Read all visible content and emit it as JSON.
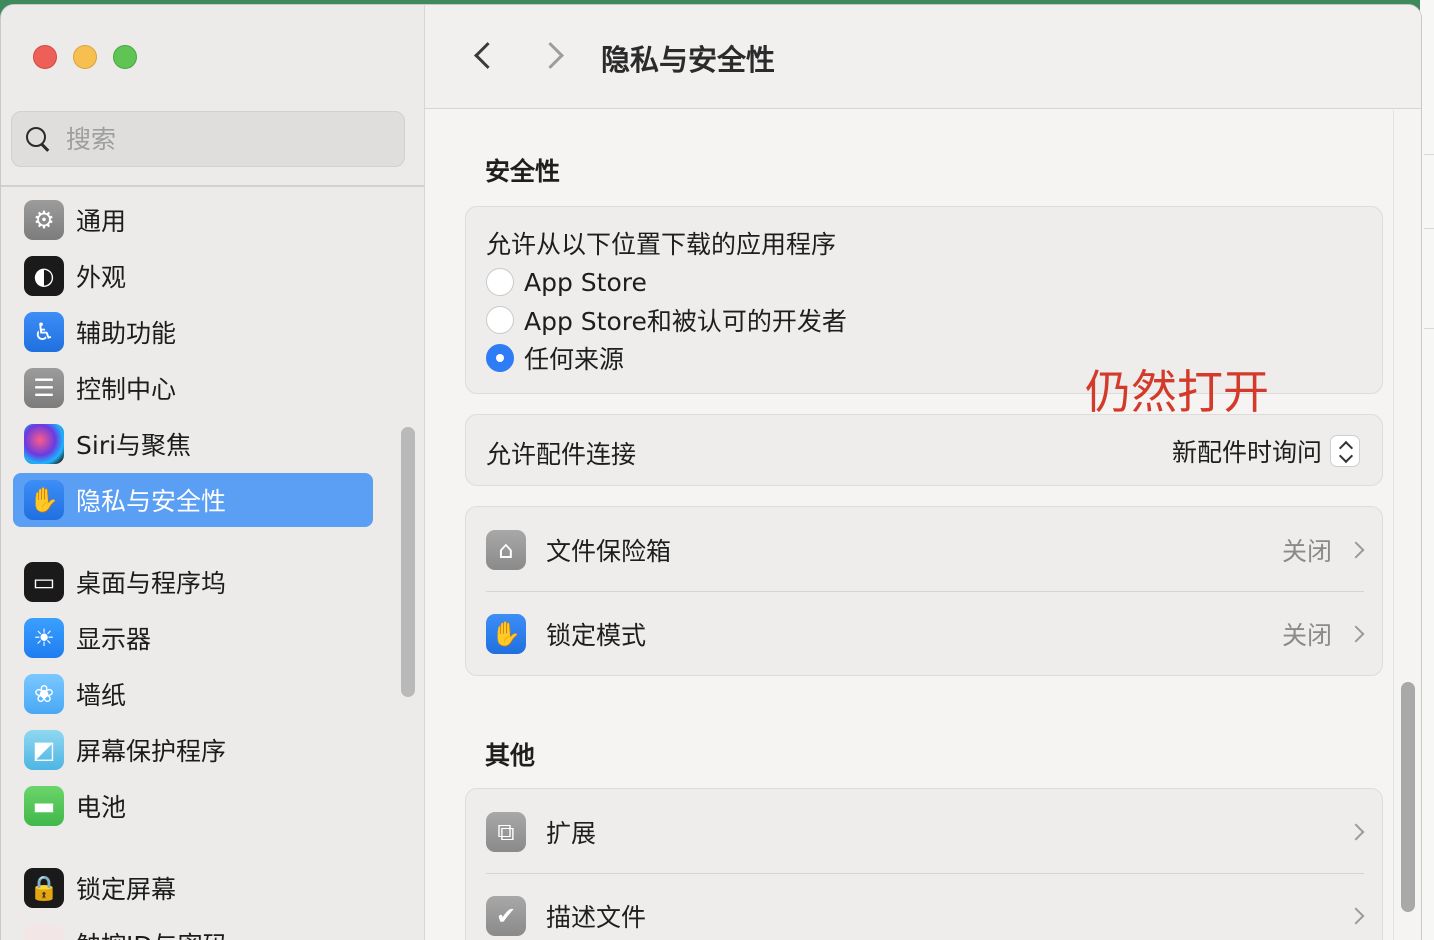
{
  "window": {
    "title": "隐私与安全性"
  },
  "search": {
    "placeholder": "搜索"
  },
  "sidebar": {
    "items": [
      {
        "label": "通用",
        "icon": "gear-icon"
      },
      {
        "label": "外观",
        "icon": "appearance-icon"
      },
      {
        "label": "辅助功能",
        "icon": "accessibility-icon"
      },
      {
        "label": "控制中心",
        "icon": "toggles-icon"
      },
      {
        "label": "Siri与聚焦",
        "icon": "siri-icon"
      },
      {
        "label": "隐私与安全性",
        "icon": "hand-icon",
        "active": true
      },
      {
        "label": "桌面与程序坞",
        "icon": "dock-icon"
      },
      {
        "label": "显示器",
        "icon": "sun-icon"
      },
      {
        "label": "墙纸",
        "icon": "flower-icon"
      },
      {
        "label": "屏幕保护程序",
        "icon": "screensaver-icon"
      },
      {
        "label": "电池",
        "icon": "battery-icon"
      },
      {
        "label": "锁定屏幕",
        "icon": "lock-icon"
      },
      {
        "label": "触控ID与密码",
        "icon": "fingerprint-icon"
      }
    ]
  },
  "security": {
    "title": "安全性",
    "download_label": "允许从以下位置下载的应用程序",
    "options": [
      {
        "label": "App Store",
        "checked": false
      },
      {
        "label": "App Store和被认可的开发者",
        "checked": false
      },
      {
        "label": "任何来源",
        "checked": true
      }
    ],
    "annotation": "仍然打开",
    "accessory_label": "允许配件连接",
    "accessory_value": "新配件时询问"
  },
  "protection": [
    {
      "label": "文件保险箱",
      "value": "关闭",
      "icon": "filevault-icon"
    },
    {
      "label": "锁定模式",
      "value": "关闭",
      "icon": "hand-icon"
    }
  ],
  "others": {
    "title": "其他",
    "items": [
      {
        "label": "扩展",
        "icon": "puzzle-icon"
      },
      {
        "label": "描述文件",
        "icon": "checkmark-badge-icon"
      }
    ]
  },
  "colors": {
    "accent": "#2e7cf6",
    "sidebar_active": "#5b9ff5",
    "annotation": "#d43a2a"
  }
}
